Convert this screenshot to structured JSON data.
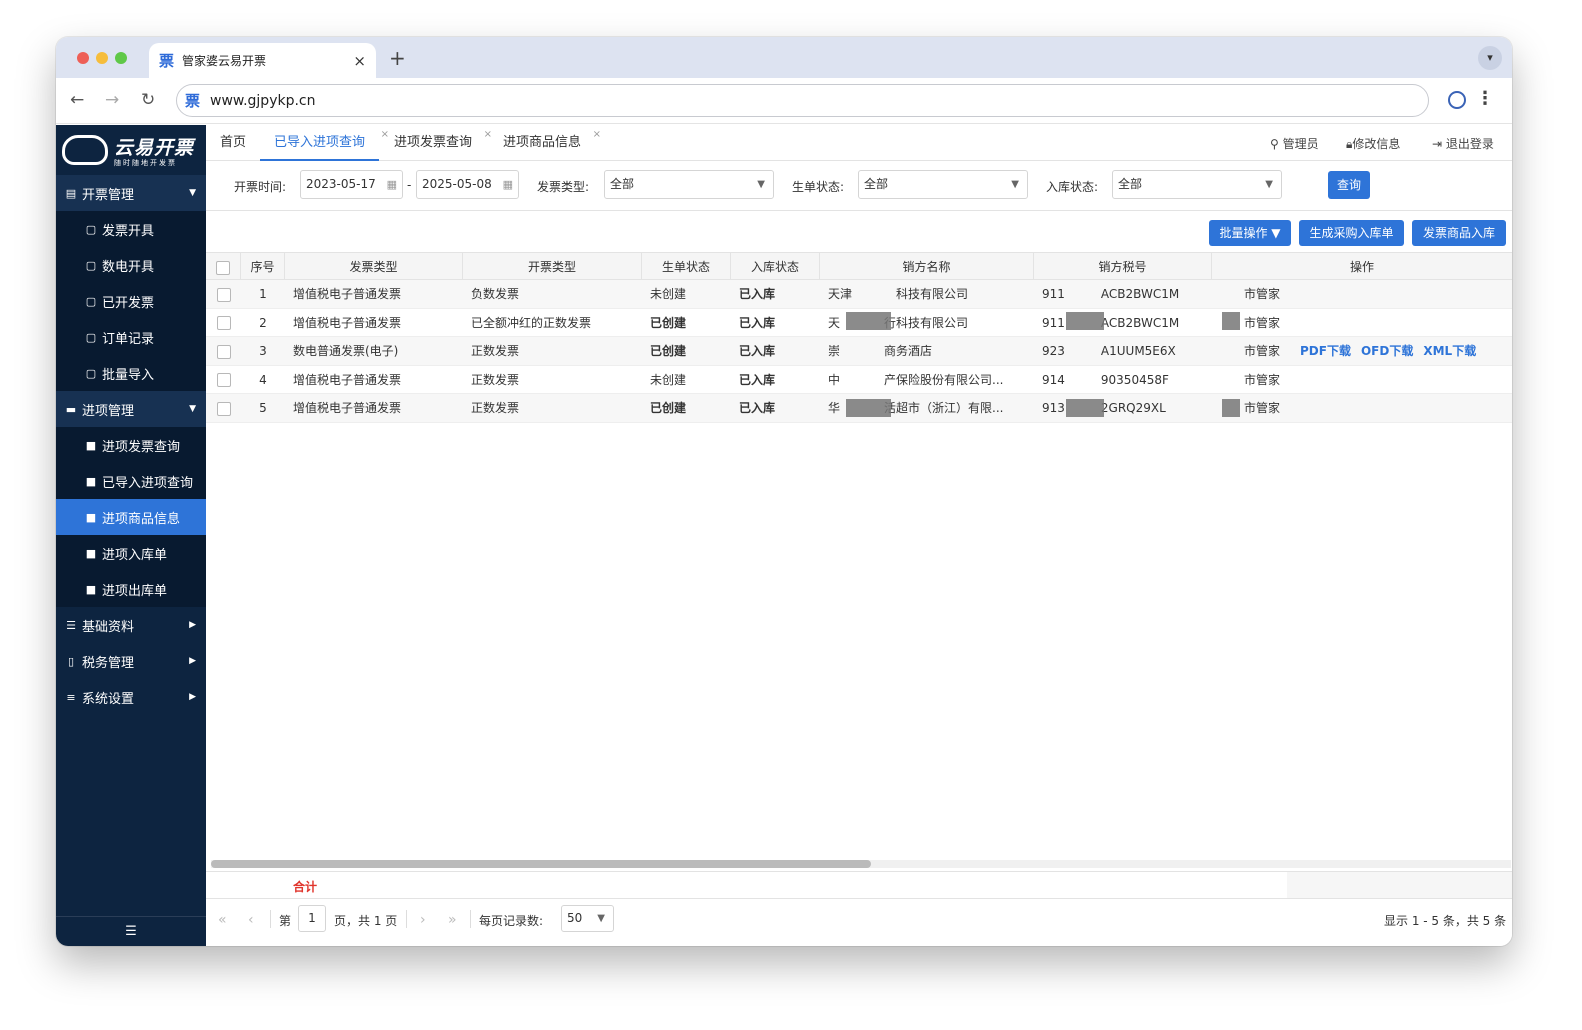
{
  "browser": {
    "tab_title": "管家婆云易开票",
    "tab_favicon": "票",
    "tab_close": "×",
    "new_tab": "+",
    "url": "www.gjpykp.cn",
    "url_favicon": "票"
  },
  "logo": {
    "title": "云易开票",
    "slogan": "随时随地开发票"
  },
  "sidebar": {
    "groups": [
      {
        "label": "开票管理",
        "items": [
          "发票开具",
          "数电开具",
          "已开发票",
          "订单记录",
          "批量导入"
        ]
      },
      {
        "label": "进项管理",
        "items": [
          "进项发票查询",
          "已导入进项查询",
          "进项商品信息",
          "进项入库单",
          "进项出库单"
        ]
      },
      {
        "label": "基础资料"
      },
      {
        "label": "税务管理"
      },
      {
        "label": "系统设置"
      }
    ],
    "active_item": "进项商品信息",
    "collapse_icon": "☰"
  },
  "page_tabs": [
    "首页",
    "已导入进项查询",
    "进项发票查询",
    "进项商品信息"
  ],
  "page_tab_close": "×",
  "top_right": {
    "admin": "管理员",
    "edit": "修改信息",
    "logout": "退出登录"
  },
  "filters": {
    "date_label": "开票时间:",
    "date_from": "2023-05-17",
    "date_sep": "-",
    "date_to": "2025-05-08",
    "invoice_type_label": "发票类型:",
    "invoice_type_value": "全部",
    "order_status_label": "生单状态:",
    "order_status_value": "全部",
    "stock_status_label": "入库状态:",
    "stock_status_value": "全部",
    "query_button": "查询"
  },
  "actions": {
    "batch": "批量操作",
    "gen_purchase": "生成采购入库单",
    "invoice_goods": "发票商品入库"
  },
  "table": {
    "headers": [
      "序号",
      "发票类型",
      "开票类型",
      "生单状态",
      "入库状态",
      "销方名称",
      "销方税号",
      "操作"
    ],
    "rows": [
      {
        "no": "1",
        "invoice_type": "增值税电子普通发票",
        "bill_type": "负数发票",
        "order_status": "未创建",
        "stock_status": "已入库",
        "seller": "天津",
        "seller2": "科技有限公司",
        "tax": "911",
        "tax2": "ACB2BWC1M",
        "buyer": "市管家"
      },
      {
        "no": "2",
        "invoice_type": "增值税电子普通发票",
        "bill_type": "已全额冲红的正数发票",
        "order_status": "已创建",
        "stock_status": "已入库",
        "seller": "天",
        "seller2": "行科技有限公司",
        "tax": "911",
        "tax2": "ACB2BWC1M",
        "buyer": "市管家"
      },
      {
        "no": "3",
        "invoice_type": "数电普通发票(电子)",
        "bill_type": "正数发票",
        "order_status": "已创建",
        "stock_status": "已入库",
        "seller": "崇",
        "seller2": "商务酒店",
        "tax": "923",
        "tax2": "A1UUM5E6X",
        "buyer": "市管家"
      },
      {
        "no": "4",
        "invoice_type": "增值税电子普通发票",
        "bill_type": "正数发票",
        "order_status": "未创建",
        "stock_status": "已入库",
        "seller": "中",
        "seller2": "产保险股份有限公司...",
        "tax": "914",
        "tax2": "90350458F",
        "buyer": "市管家"
      },
      {
        "no": "5",
        "invoice_type": "增值税电子普通发票",
        "bill_type": "正数发票",
        "order_status": "已创建",
        "stock_status": "已入库",
        "seller": "华",
        "seller2": "活超市（浙江）有限...",
        "tax": "913",
        "tax2": "2GRQ29XL",
        "buyer": "市管家"
      }
    ],
    "links": {
      "pdf": "PDF下载",
      "ofd": "OFD下载",
      "xml": "XML下载"
    }
  },
  "summary": {
    "label": "合计"
  },
  "pager": {
    "page_prefix": "第",
    "page": "1",
    "page_suffix": "页，共 1 页",
    "per_page_label": "每页记录数:",
    "per_page": "50",
    "display": "显示 1 - 5 条，共 5 条"
  },
  "colors": {
    "accent": "#2e74d8",
    "sidebar": "#0d2440",
    "green": "#2a9a2a",
    "red": "#e0342b"
  }
}
